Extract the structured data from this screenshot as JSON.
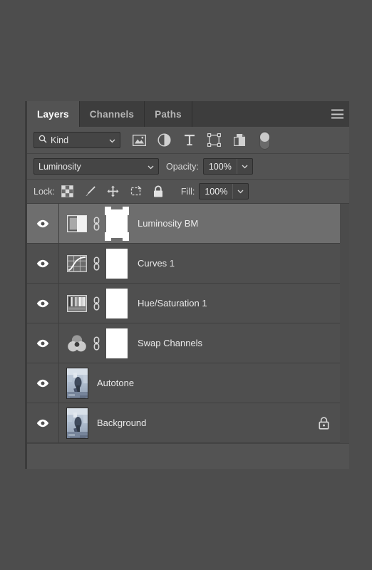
{
  "panel": {
    "tabs": [
      {
        "label": "Layers",
        "active": true
      },
      {
        "label": "Channels",
        "active": false
      },
      {
        "label": "Paths",
        "active": false
      }
    ],
    "menu_icon": "hamburger-menu-icon"
  },
  "filter": {
    "kind_label": "Kind",
    "search_icon": "search-icon",
    "chevron_icon": "chevron-down-icon",
    "icons": [
      {
        "name": "filter-pixel-layers-icon",
        "title": "Pixel layers"
      },
      {
        "name": "filter-adjustment-layers-icon",
        "title": "Adjustment layers"
      },
      {
        "name": "filter-type-layers-icon",
        "title": "Type layers"
      },
      {
        "name": "filter-shape-layers-icon",
        "title": "Shape layers"
      },
      {
        "name": "filter-smart-objects-icon",
        "title": "Smart objects"
      }
    ],
    "toggle_name": "filter-enable-toggle"
  },
  "blend": {
    "mode": "Luminosity",
    "opacity_label": "Opacity:",
    "opacity_value": "100%",
    "fill_label": "Fill:",
    "fill_value": "100%"
  },
  "lock": {
    "label": "Lock:",
    "icons": [
      {
        "name": "lock-transparent-pixels-icon"
      },
      {
        "name": "lock-image-pixels-icon"
      },
      {
        "name": "lock-position-icon"
      },
      {
        "name": "lock-artboard-nesting-icon"
      },
      {
        "name": "lock-all-icon"
      }
    ]
  },
  "layers": [
    {
      "name": "Luminosity BM",
      "visible": true,
      "selected": true,
      "thumb_type": "adjustment",
      "adjustment_icon": "black-and-white-adjustment-icon",
      "linked": true,
      "has_mask": true,
      "mask_active": true,
      "locked": false
    },
    {
      "name": "Curves 1",
      "visible": true,
      "selected": false,
      "thumb_type": "adjustment",
      "adjustment_icon": "curves-adjustment-icon",
      "linked": true,
      "has_mask": true,
      "mask_active": false,
      "locked": false
    },
    {
      "name": "Hue/Saturation 1",
      "visible": true,
      "selected": false,
      "thumb_type": "adjustment",
      "adjustment_icon": "hue-saturation-adjustment-icon",
      "linked": true,
      "has_mask": true,
      "mask_active": false,
      "locked": false
    },
    {
      "name": "Swap Channels",
      "visible": true,
      "selected": false,
      "thumb_type": "adjustment",
      "adjustment_icon": "channel-mixer-adjustment-icon",
      "linked": true,
      "has_mask": true,
      "mask_active": false,
      "locked": false
    },
    {
      "name": "Autotone",
      "visible": true,
      "selected": false,
      "thumb_type": "photo",
      "linked": false,
      "has_mask": false,
      "mask_active": false,
      "locked": false
    },
    {
      "name": "Background",
      "visible": true,
      "selected": false,
      "thumb_type": "photo",
      "linked": false,
      "has_mask": false,
      "mask_active": false,
      "locked": true,
      "lock_icon": "padlock-icon"
    }
  ],
  "colors": {
    "panel_bg": "#535353",
    "tab_bg": "#3d3d3d",
    "row_bg": "#4f4f4f",
    "row_selected_bg": "#6e6e6e",
    "text": "#eaeaea",
    "field_bg": "#454545"
  }
}
